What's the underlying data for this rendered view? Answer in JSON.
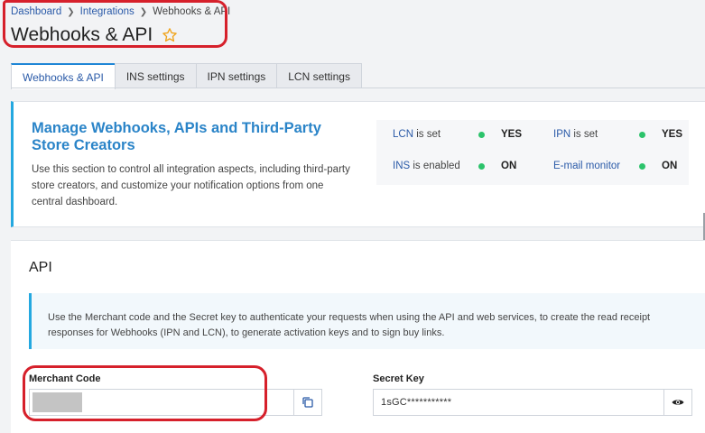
{
  "breadcrumb": {
    "items": [
      "Dashboard",
      "Integrations"
    ],
    "current": "Webhooks & API"
  },
  "page": {
    "title": "Webhooks & API"
  },
  "tabs": [
    {
      "label": "Webhooks & API",
      "active": true
    },
    {
      "label": "INS settings",
      "active": false
    },
    {
      "label": "IPN settings",
      "active": false
    },
    {
      "label": "LCN settings",
      "active": false
    }
  ],
  "overview": {
    "title": "Manage Webhooks, APIs and Third-Party Store Creators",
    "description": "Use this section to control all integration aspects, including third-party store creators, and customize your notification options from one central dashboard.",
    "status": [
      {
        "key": "LCN",
        "suffix": "is set",
        "value": "YES"
      },
      {
        "key": "IPN",
        "suffix": "is set",
        "value": "YES"
      },
      {
        "key": "INS",
        "suffix": "is enabled",
        "value": "ON"
      },
      {
        "key": "E-mail monitor",
        "suffix": "",
        "value": "ON"
      }
    ]
  },
  "api": {
    "heading": "API",
    "info": "Use the Merchant code and the Secret key to authenticate your requests when using the API and web services, to create the read receipt responses for Webhooks (IPN and LCN), to generate activation keys and to sign buy links.",
    "merchant_code_label": "Merchant Code",
    "merchant_code_value": "",
    "secret_key_label": "Secret Key",
    "secret_key_value": "1sGC***********"
  },
  "colors": {
    "accent": "#24a8e0",
    "link": "#2a5aa8",
    "status_green": "#2cc36b",
    "annotation_red": "#d6202b"
  },
  "icons": {
    "favorite": "star-icon",
    "copy": "copy-icon",
    "reveal": "eye-icon"
  }
}
